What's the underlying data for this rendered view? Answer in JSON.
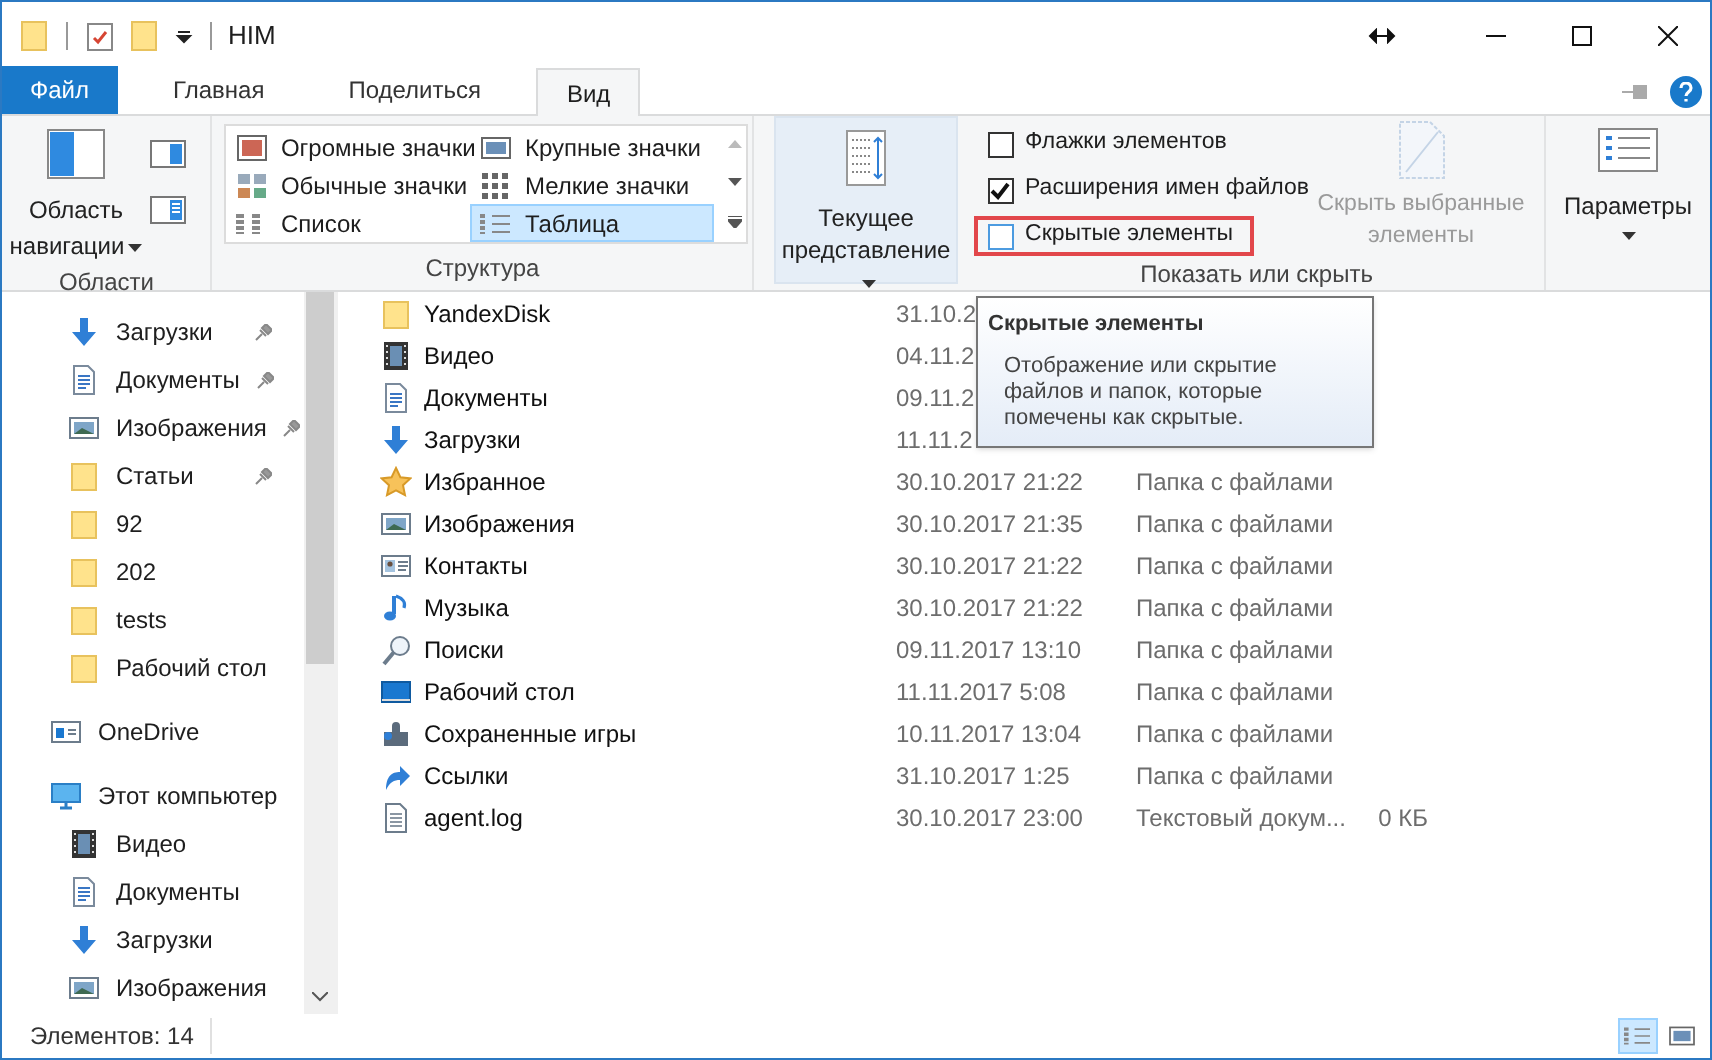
{
  "window": {
    "title": "HIM"
  },
  "tabs": [
    {
      "label": "Файл",
      "kind": "file",
      "selected": false
    },
    {
      "label": "Главная",
      "kind": "tab",
      "selected": false
    },
    {
      "label": "Поделиться",
      "kind": "tab",
      "selected": false
    },
    {
      "label": "Вид",
      "kind": "tab",
      "selected": true
    }
  ],
  "ribbon": {
    "panes": {
      "nav_button": "Область навигации",
      "label": "Области"
    },
    "layout": {
      "label": "Структура",
      "options": [
        {
          "label": "Огромные значки",
          "kind": "huge",
          "selected": false
        },
        {
          "label": "Крупные значки",
          "kind": "large",
          "selected": false
        },
        {
          "label": "Обычные значки",
          "kind": "medium",
          "selected": false
        },
        {
          "label": "Мелкие значки",
          "kind": "small",
          "selected": false
        },
        {
          "label": "Список",
          "kind": "list",
          "selected": false
        },
        {
          "label": "Таблица",
          "kind": "details",
          "selected": true
        }
      ]
    },
    "current_view": {
      "label": "Текущее представление"
    },
    "show_hide": {
      "label": "Показать или скрыть",
      "checkboxes": [
        {
          "label": "Флажки элементов",
          "checked": false,
          "highlighted": false
        },
        {
          "label": "Расширения имен файлов",
          "checked": true,
          "highlighted": false
        },
        {
          "label": "Скрытые элементы",
          "checked": false,
          "highlighted": true
        }
      ],
      "hide_selected": {
        "label": "Скрыть выбранные элементы",
        "disabled": true
      }
    },
    "options": {
      "label": "Параметры"
    }
  },
  "nav": {
    "quick_access": [
      {
        "label": "Загрузки",
        "kind": "download",
        "pinned": true
      },
      {
        "label": "Документы",
        "kind": "docs",
        "pinned": true
      },
      {
        "label": "Изображения",
        "kind": "images",
        "pinned": true
      },
      {
        "label": "Статьи",
        "kind": "folder",
        "pinned": true
      },
      {
        "label": "92",
        "kind": "folder",
        "pinned": false
      },
      {
        "label": "202",
        "kind": "folder",
        "pinned": false
      },
      {
        "label": "tests",
        "kind": "folder",
        "pinned": false
      },
      {
        "label": "Рабочий стол",
        "kind": "folder",
        "pinned": false
      }
    ],
    "locations": [
      {
        "label": "OneDrive",
        "kind": "onedrive"
      },
      {
        "label": "Этот компьютер",
        "kind": "pc",
        "children": [
          {
            "label": "Видео",
            "kind": "video"
          },
          {
            "label": "Документы",
            "kind": "docs"
          },
          {
            "label": "Загрузки",
            "kind": "download"
          },
          {
            "label": "Изображения",
            "kind": "images"
          }
        ]
      }
    ]
  },
  "files": [
    {
      "name": "YandexDisk",
      "kind": "folder",
      "date": "31.10.2"
    },
    {
      "name": "Видео",
      "kind": "video",
      "date": "04.11.2"
    },
    {
      "name": "Документы",
      "kind": "docs",
      "date": "09.11.2"
    },
    {
      "name": "Загрузки",
      "kind": "download",
      "date": "11.11.2"
    },
    {
      "name": "Избранное",
      "kind": "star",
      "date": "30.10.2017 21:22",
      "type": "Папка с файлами"
    },
    {
      "name": "Изображения",
      "kind": "images",
      "date": "30.10.2017 21:35",
      "type": "Папка с файлами"
    },
    {
      "name": "Контакты",
      "kind": "contacts",
      "date": "30.10.2017 21:22",
      "type": "Папка с файлами"
    },
    {
      "name": "Музыка",
      "kind": "music",
      "date": "30.10.2017 21:22",
      "type": "Папка с файлами"
    },
    {
      "name": "Поиски",
      "kind": "search",
      "date": "09.11.2017 13:10",
      "type": "Папка с файлами"
    },
    {
      "name": "Рабочий стол",
      "kind": "desktop",
      "date": "11.11.2017 5:08",
      "type": "Папка с файлами"
    },
    {
      "name": "Сохраненные игры",
      "kind": "games",
      "date": "10.11.2017 13:04",
      "type": "Папка с файлами"
    },
    {
      "name": "Ссылки",
      "kind": "links",
      "date": "31.10.2017 1:25",
      "type": "Папка с файлами"
    },
    {
      "name": "agent.log",
      "kind": "text",
      "date": "30.10.2017 23:00",
      "type": "Текстовый докум...",
      "size": "0 КБ"
    }
  ],
  "tooltip": {
    "title": "Скрытые элементы",
    "text": "Отображение или скрытие файлов и папок, которые помечены как скрытые."
  },
  "status_bar": {
    "count": "Элементов: 14",
    "views": [
      {
        "kind": "details",
        "selected": true
      },
      {
        "kind": "thumbs",
        "selected": false
      }
    ]
  }
}
